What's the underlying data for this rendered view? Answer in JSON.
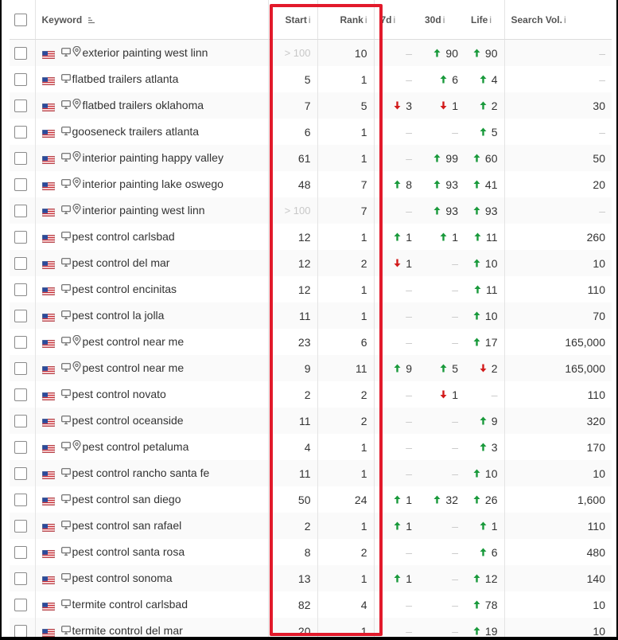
{
  "header": {
    "keyword": "Keyword",
    "start": "Start",
    "rank": "Rank",
    "d7": "7d",
    "d30": "30d",
    "life": "Life",
    "search_vol": "Search Vol.",
    "info_glyph": "i"
  },
  "colors": {
    "up": "#1a9a3c",
    "down": "#d21b1b",
    "highlight": "#e21a2b"
  },
  "icons": {
    "device": "desktop-icon",
    "location": "map-pin-icon",
    "country": "us-flag-icon",
    "up": "arrow-up-icon",
    "down": "arrow-down-icon"
  },
  "rows": [
    {
      "keyword": "exterior painting west linn",
      "pin": true,
      "start": "> 100",
      "start_muted": true,
      "rank": "10",
      "d7": "–",
      "d7_dir": "",
      "d30": "90",
      "d30_dir": "up",
      "life": "90",
      "life_dir": "up",
      "sv": "–"
    },
    {
      "keyword": "flatbed trailers atlanta",
      "pin": false,
      "start": "5",
      "start_muted": false,
      "rank": "1",
      "d7": "–",
      "d7_dir": "",
      "d30": "6",
      "d30_dir": "up",
      "life": "4",
      "life_dir": "up",
      "sv": "–"
    },
    {
      "keyword": "flatbed trailers oklahoma",
      "pin": true,
      "start": "7",
      "start_muted": false,
      "rank": "5",
      "d7": "3",
      "d7_dir": "down",
      "d30": "1",
      "d30_dir": "down",
      "life": "2",
      "life_dir": "up",
      "sv": "30"
    },
    {
      "keyword": "gooseneck trailers atlanta",
      "pin": false,
      "start": "6",
      "start_muted": false,
      "rank": "1",
      "d7": "–",
      "d7_dir": "",
      "d30": "–",
      "d30_dir": "",
      "life": "5",
      "life_dir": "up",
      "sv": "–"
    },
    {
      "keyword": "interior painting happy valley",
      "pin": true,
      "start": "61",
      "start_muted": false,
      "rank": "1",
      "d7": "–",
      "d7_dir": "",
      "d30": "99",
      "d30_dir": "up",
      "life": "60",
      "life_dir": "up",
      "sv": "50"
    },
    {
      "keyword": "interior painting lake oswego",
      "pin": true,
      "start": "48",
      "start_muted": false,
      "rank": "7",
      "d7": "8",
      "d7_dir": "up",
      "d30": "93",
      "d30_dir": "up",
      "life": "41",
      "life_dir": "up",
      "sv": "20"
    },
    {
      "keyword": "interior painting west linn",
      "pin": true,
      "start": "> 100",
      "start_muted": true,
      "rank": "7",
      "d7": "–",
      "d7_dir": "",
      "d30": "93",
      "d30_dir": "up",
      "life": "93",
      "life_dir": "up",
      "sv": "–"
    },
    {
      "keyword": "pest control carlsbad",
      "pin": false,
      "start": "12",
      "start_muted": false,
      "rank": "1",
      "d7": "1",
      "d7_dir": "up",
      "d30": "1",
      "d30_dir": "up",
      "life": "11",
      "life_dir": "up",
      "sv": "260"
    },
    {
      "keyword": "pest control del mar",
      "pin": false,
      "start": "12",
      "start_muted": false,
      "rank": "2",
      "d7": "1",
      "d7_dir": "down",
      "d30": "–",
      "d30_dir": "",
      "life": "10",
      "life_dir": "up",
      "sv": "10"
    },
    {
      "keyword": "pest control encinitas",
      "pin": false,
      "start": "12",
      "start_muted": false,
      "rank": "1",
      "d7": "–",
      "d7_dir": "",
      "d30": "–",
      "d30_dir": "",
      "life": "11",
      "life_dir": "up",
      "sv": "110"
    },
    {
      "keyword": "pest control la jolla",
      "pin": false,
      "start": "11",
      "start_muted": false,
      "rank": "1",
      "d7": "–",
      "d7_dir": "",
      "d30": "–",
      "d30_dir": "",
      "life": "10",
      "life_dir": "up",
      "sv": "70"
    },
    {
      "keyword": "pest control near me",
      "pin": true,
      "start": "23",
      "start_muted": false,
      "rank": "6",
      "d7": "–",
      "d7_dir": "",
      "d30": "–",
      "d30_dir": "",
      "life": "17",
      "life_dir": "up",
      "sv": "165,000"
    },
    {
      "keyword": "pest control near me",
      "pin": true,
      "start": "9",
      "start_muted": false,
      "rank": "11",
      "d7": "9",
      "d7_dir": "up",
      "d30": "5",
      "d30_dir": "up",
      "life": "2",
      "life_dir": "down",
      "sv": "165,000"
    },
    {
      "keyword": "pest control novato",
      "pin": false,
      "start": "2",
      "start_muted": false,
      "rank": "2",
      "d7": "–",
      "d7_dir": "",
      "d30": "1",
      "d30_dir": "down",
      "life": "–",
      "life_dir": "",
      "sv": "110"
    },
    {
      "keyword": "pest control oceanside",
      "pin": false,
      "start": "11",
      "start_muted": false,
      "rank": "2",
      "d7": "–",
      "d7_dir": "",
      "d30": "–",
      "d30_dir": "",
      "life": "9",
      "life_dir": "up",
      "sv": "320"
    },
    {
      "keyword": "pest control petaluma",
      "pin": true,
      "start": "4",
      "start_muted": false,
      "rank": "1",
      "d7": "–",
      "d7_dir": "",
      "d30": "–",
      "d30_dir": "",
      "life": "3",
      "life_dir": "up",
      "sv": "170"
    },
    {
      "keyword": "pest control rancho santa fe",
      "pin": false,
      "start": "11",
      "start_muted": false,
      "rank": "1",
      "d7": "–",
      "d7_dir": "",
      "d30": "–",
      "d30_dir": "",
      "life": "10",
      "life_dir": "up",
      "sv": "10"
    },
    {
      "keyword": "pest control san diego",
      "pin": false,
      "start": "50",
      "start_muted": false,
      "rank": "24",
      "d7": "1",
      "d7_dir": "up",
      "d30": "32",
      "d30_dir": "up",
      "life": "26",
      "life_dir": "up",
      "sv": "1,600"
    },
    {
      "keyword": "pest control san rafael",
      "pin": false,
      "start": "2",
      "start_muted": false,
      "rank": "1",
      "d7": "1",
      "d7_dir": "up",
      "d30": "–",
      "d30_dir": "",
      "life": "1",
      "life_dir": "up",
      "sv": "110"
    },
    {
      "keyword": "pest control santa rosa",
      "pin": false,
      "start": "8",
      "start_muted": false,
      "rank": "2",
      "d7": "–",
      "d7_dir": "",
      "d30": "–",
      "d30_dir": "",
      "life": "6",
      "life_dir": "up",
      "sv": "480"
    },
    {
      "keyword": "pest control sonoma",
      "pin": false,
      "start": "13",
      "start_muted": false,
      "rank": "1",
      "d7": "1",
      "d7_dir": "up",
      "d30": "–",
      "d30_dir": "",
      "life": "12",
      "life_dir": "up",
      "sv": "140"
    },
    {
      "keyword": "termite control carlsbad",
      "pin": false,
      "start": "82",
      "start_muted": false,
      "rank": "4",
      "d7": "–",
      "d7_dir": "",
      "d30": "–",
      "d30_dir": "",
      "life": "78",
      "life_dir": "up",
      "sv": "10"
    },
    {
      "keyword": "termite control del mar",
      "pin": false,
      "start": "20",
      "start_muted": false,
      "rank": "1",
      "d7": "–",
      "d7_dir": "",
      "d30": "–",
      "d30_dir": "",
      "life": "19",
      "life_dir": "up",
      "sv": "10"
    }
  ]
}
